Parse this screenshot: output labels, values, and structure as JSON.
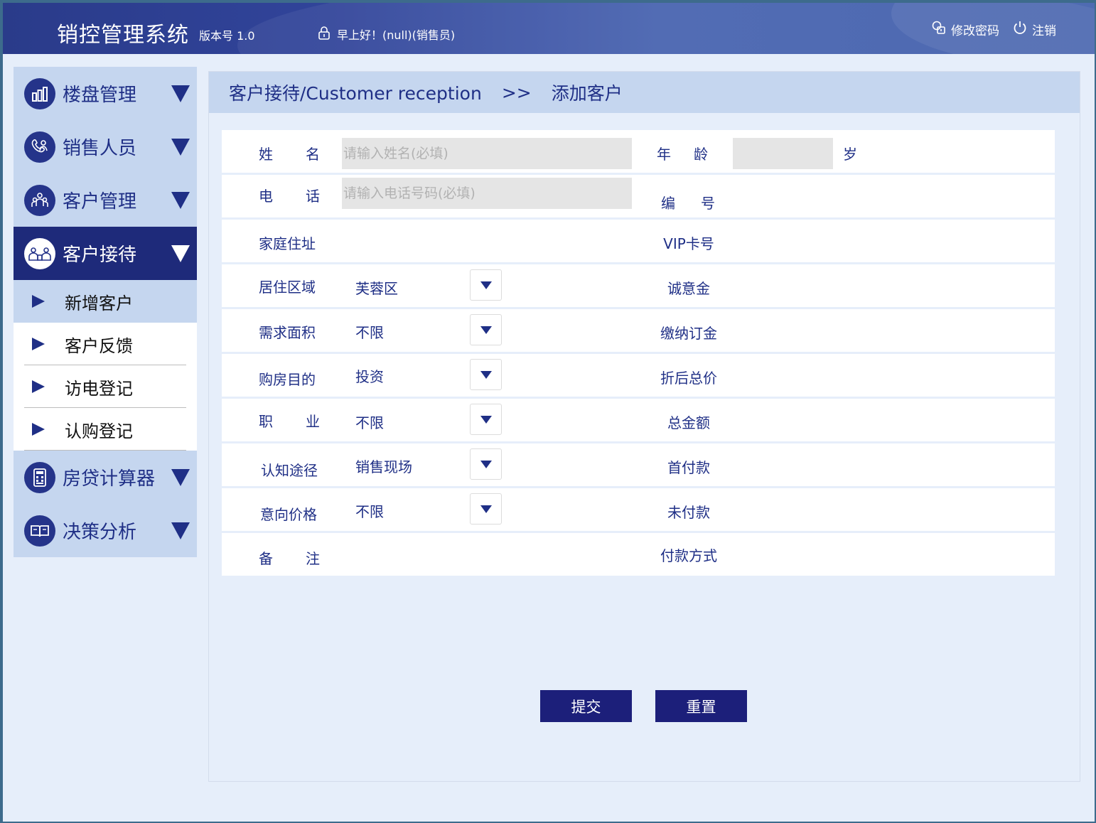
{
  "header": {
    "title": "销控管理系统",
    "version": "版本号 1.0",
    "greeting": "早上好！(null)(销售员)",
    "change_password": "修改密码",
    "logout": "注销"
  },
  "sidebar": {
    "menu": [
      {
        "label": "楼盘管理",
        "icon": "building-chart-icon"
      },
      {
        "label": "销售人员",
        "icon": "telephone-person-icon"
      },
      {
        "label": "客户管理",
        "icon": "people-group-icon"
      },
      {
        "label": "客户接待",
        "icon": "reception-people-icon"
      },
      {
        "label": "房贷计算器",
        "icon": "calculator-icon"
      },
      {
        "label": "决策分析",
        "icon": "book-icon"
      }
    ],
    "submenu": [
      {
        "label": "新增客户"
      },
      {
        "label": "客户反馈"
      },
      {
        "label": "访电登记"
      },
      {
        "label": "认购登记"
      }
    ]
  },
  "breadcrumb": {
    "section": "客户接待/Customer reception",
    "separator": ">>",
    "page": "添加客户"
  },
  "form": {
    "name_label": "姓　名",
    "name_placeholder": "请输入姓名(必填)",
    "age_label": "年　龄",
    "age_unit": "岁",
    "phone_label": "电　话",
    "phone_placeholder": "请输入电话号码(必填)",
    "number_label": "编　号",
    "address_label": "家庭住址",
    "vip_label": "VIP卡号",
    "area_label": "居住区域",
    "area_value": "芙蓉区",
    "deposit_label": "诚意金",
    "size_label": "需求面积",
    "size_value": "不限",
    "down_deposit_label": "缴纳订金",
    "purpose_label": "购房目的",
    "purpose_value": "投资",
    "discount_total_label": "折后总价",
    "job_label": "职　业",
    "job_value": "不限",
    "total_label": "总金额",
    "channel_label": "认知途径",
    "channel_value": "销售现场",
    "first_pay_label": "首付款",
    "price_label": "意向价格",
    "price_value": "不限",
    "unpaid_label": "未付款",
    "remark_label": "备　注",
    "pay_method_label": "付款方式"
  },
  "buttons": {
    "submit": "提交",
    "reset": "重置"
  },
  "colors": {
    "header_bg": "#31449a",
    "sidebar_bg": "#c5d6ef",
    "accent": "#1e2a7a",
    "text": "#1f2f86"
  }
}
